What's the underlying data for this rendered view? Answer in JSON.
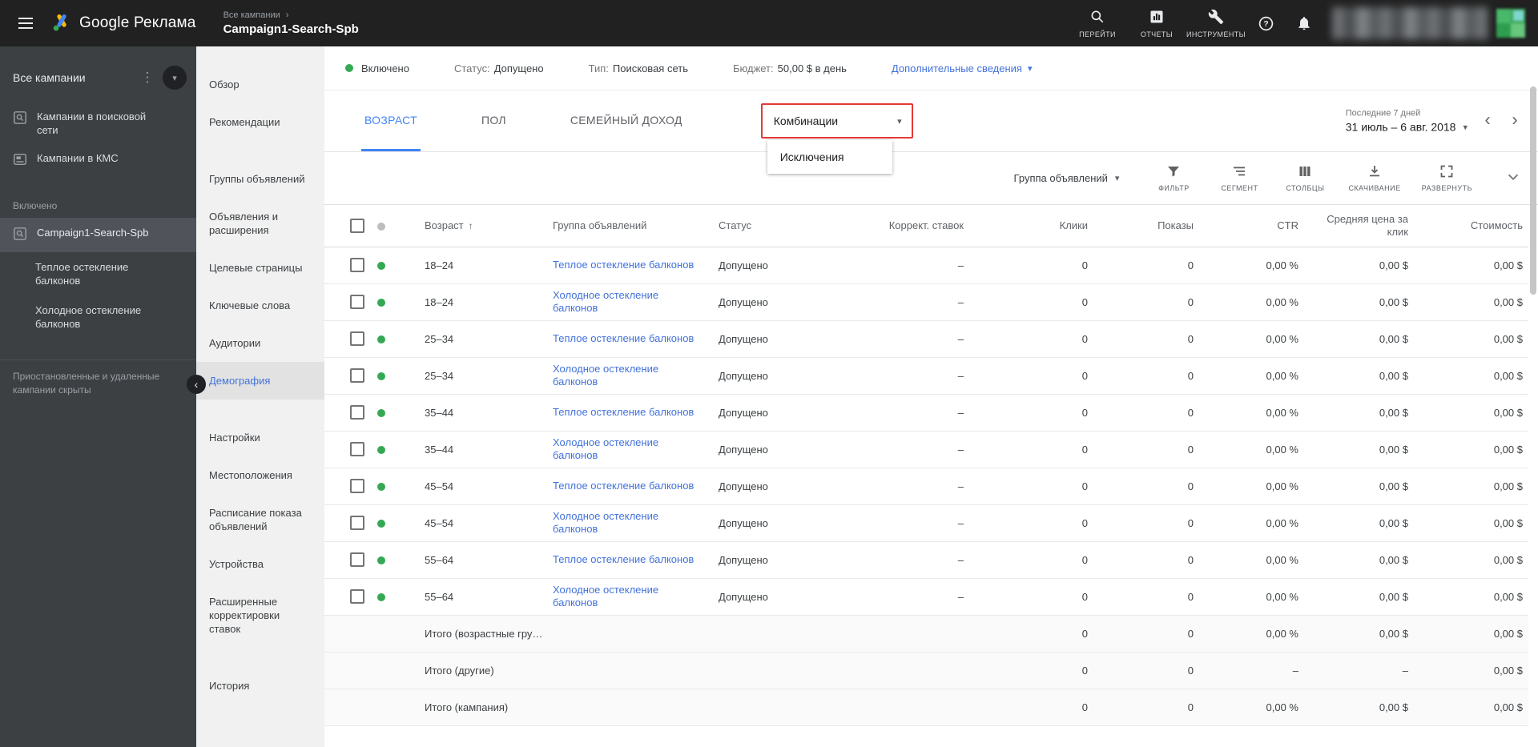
{
  "colors": {
    "topbar_bg": "#212121",
    "sidebar_bg": "#3c4043",
    "accent_blue": "#4285f4",
    "link_blue": "#4272db",
    "green_dot": "#34a853",
    "highlight_red": "#e53935"
  },
  "topbar": {
    "brand": "Google Реклама",
    "breadcrumb": "Все кампании",
    "breadcrumb_chevron": "›",
    "campaign": "Campaign1-Search-Spb",
    "nav": [
      {
        "label": "ПЕРЕЙТИ",
        "icon": "search"
      },
      {
        "label": "ОТЧЕТЫ",
        "icon": "reports"
      },
      {
        "label": "ИНСТРУМЕНТЫ",
        "icon": "tools"
      }
    ]
  },
  "sidebar": {
    "title": "Все кампании",
    "types": [
      {
        "label": "Кампании в поисковой сети",
        "icon": "search-campaign"
      },
      {
        "label": "Кампании в КМС",
        "icon": "display-campaign"
      }
    ],
    "section": "Включено",
    "campaigns": [
      {
        "label": "Campaign1-Search-Spb",
        "kind": "campaign",
        "selected": true
      },
      {
        "label": "Теплое остекление балконов",
        "kind": "adgroup",
        "selected": false
      },
      {
        "label": "Холодное остекление балконов",
        "kind": "adgroup",
        "selected": false
      }
    ],
    "footnote": "Приостановленные и удаленные кампании скрыты"
  },
  "menu": {
    "groups": [
      [
        "Обзор",
        "Рекомендации"
      ],
      [
        "Группы объявлений",
        "Объявления и расширения",
        "Целевые страницы",
        "Ключевые слова",
        "Аудитории",
        "Демография"
      ],
      [
        "Настройки",
        "Местоположения",
        "Расписание показа объявлений",
        "Устройства",
        "Расширенные корректировки ставок"
      ],
      [
        "История"
      ]
    ],
    "selected": "Демография"
  },
  "statusbar": {
    "state": "Включено",
    "pairs": [
      {
        "label": "Статус:",
        "value": "Допущено"
      },
      {
        "label": "Тип:",
        "value": "Поисковая сеть"
      },
      {
        "label": "Бюджет:",
        "value": "50,00 $ в день"
      }
    ],
    "more": "Дополнительные сведения"
  },
  "tabs": {
    "items": [
      "ВОЗРАСТ",
      "ПОЛ",
      "СЕМЕЙНЫЙ ДОХОД"
    ],
    "active": "ВОЗРАСТ",
    "dropdown": {
      "label": "Комбинации",
      "menu_item": "Исключения"
    }
  },
  "daterange": {
    "preset": "Последние 7 дней",
    "range": "31 июль – 6 авг. 2018"
  },
  "toolbar": {
    "group_by": "Группа объявлений",
    "buttons": [
      {
        "label": "ФИЛЬТР",
        "icon": "filter"
      },
      {
        "label": "СЕГМЕНТ",
        "icon": "segment"
      },
      {
        "label": "СТОЛБЦЫ",
        "icon": "columns"
      },
      {
        "label": "СКАЧИВАНИЕ",
        "icon": "download"
      },
      {
        "label": "РАЗВЕРНУТЬ",
        "icon": "expand"
      }
    ]
  },
  "table": {
    "columns": [
      "Возраст",
      "Группа объявлений",
      "Статус",
      "Коррект. ставок",
      "Клики",
      "Показы",
      "CTR",
      "Средняя цена за клик",
      "Стоимость"
    ],
    "sort_column": "Возраст",
    "rows": [
      {
        "age": "18–24",
        "group": "Теплое остекление балконов",
        "status": "Допущено",
        "adj": "–",
        "clicks": "0",
        "impressions": "0",
        "ctr": "0,00 %",
        "avg_cpc": "0,00 $",
        "cost": "0,00 $"
      },
      {
        "age": "18–24",
        "group": "Холодное остекление балконов",
        "status": "Допущено",
        "adj": "–",
        "clicks": "0",
        "impressions": "0",
        "ctr": "0,00 %",
        "avg_cpc": "0,00 $",
        "cost": "0,00 $"
      },
      {
        "age": "25–34",
        "group": "Теплое остекление балконов",
        "status": "Допущено",
        "adj": "–",
        "clicks": "0",
        "impressions": "0",
        "ctr": "0,00 %",
        "avg_cpc": "0,00 $",
        "cost": "0,00 $"
      },
      {
        "age": "25–34",
        "group": "Холодное остекление балконов",
        "status": "Допущено",
        "adj": "–",
        "clicks": "0",
        "impressions": "0",
        "ctr": "0,00 %",
        "avg_cpc": "0,00 $",
        "cost": "0,00 $"
      },
      {
        "age": "35–44",
        "group": "Теплое остекление балконов",
        "status": "Допущено",
        "adj": "–",
        "clicks": "0",
        "impressions": "0",
        "ctr": "0,00 %",
        "avg_cpc": "0,00 $",
        "cost": "0,00 $"
      },
      {
        "age": "35–44",
        "group": "Холодное остекление балконов",
        "status": "Допущено",
        "adj": "–",
        "clicks": "0",
        "impressions": "0",
        "ctr": "0,00 %",
        "avg_cpc": "0,00 $",
        "cost": "0,00 $"
      },
      {
        "age": "45–54",
        "group": "Теплое остекление балконов",
        "status": "Допущено",
        "adj": "–",
        "clicks": "0",
        "impressions": "0",
        "ctr": "0,00 %",
        "avg_cpc": "0,00 $",
        "cost": "0,00 $"
      },
      {
        "age": "45–54",
        "group": "Холодное остекление балконов",
        "status": "Допущено",
        "adj": "–",
        "clicks": "0",
        "impressions": "0",
        "ctr": "0,00 %",
        "avg_cpc": "0,00 $",
        "cost": "0,00 $"
      },
      {
        "age": "55–64",
        "group": "Теплое остекление балконов",
        "status": "Допущено",
        "adj": "–",
        "clicks": "0",
        "impressions": "0",
        "ctr": "0,00 %",
        "avg_cpc": "0,00 $",
        "cost": "0,00 $"
      },
      {
        "age": "55–64",
        "group": "Холодное остекление балконов",
        "status": "Допущено",
        "adj": "–",
        "clicks": "0",
        "impressions": "0",
        "ctr": "0,00 %",
        "avg_cpc": "0,00 $",
        "cost": "0,00 $"
      }
    ],
    "totals": [
      {
        "label": "Итого (возрастные гру…",
        "clicks": "0",
        "impressions": "0",
        "ctr": "0,00 %",
        "avg_cpc": "0,00 $",
        "cost": "0,00 $"
      },
      {
        "label": "Итого (другие)",
        "clicks": "0",
        "impressions": "0",
        "ctr": "–",
        "avg_cpc": "–",
        "cost": "0,00 $"
      },
      {
        "label": "Итого (кампания)",
        "clicks": "0",
        "impressions": "0",
        "ctr": "0,00 %",
        "avg_cpc": "0,00 $",
        "cost": "0,00 $"
      }
    ]
  }
}
